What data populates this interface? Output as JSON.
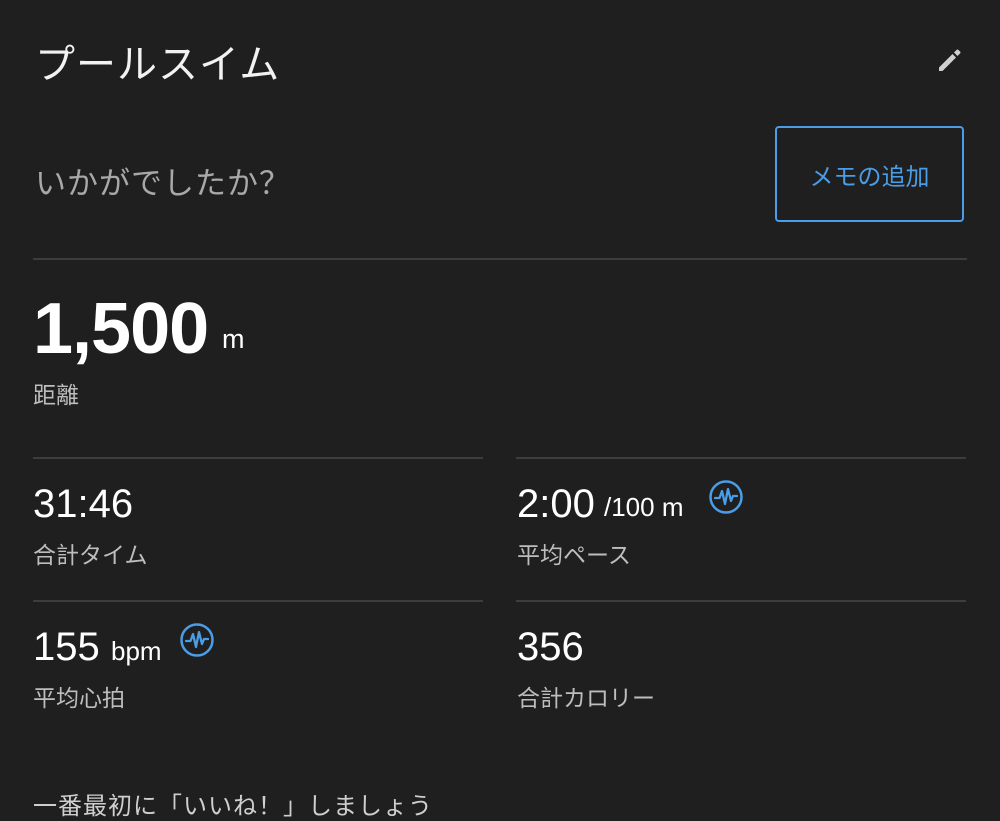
{
  "header": {
    "title": "プールスイム",
    "edit_icon": "pencil-icon"
  },
  "feedback": {
    "question": "いかがでしたか？",
    "memo_button": "メモの追加"
  },
  "distance": {
    "value": "1,500",
    "unit": "m",
    "label": "距離"
  },
  "stats": {
    "total_time": {
      "value": "31:46",
      "label": "合計タイム"
    },
    "avg_pace": {
      "value": "2:00",
      "unit": "/100 m",
      "label": "平均ペース",
      "icon": "heart-rate-icon"
    },
    "avg_hr": {
      "value": "155",
      "unit": "bpm",
      "label": "平均心拍",
      "icon": "heart-rate-icon"
    },
    "calories": {
      "value": "356",
      "label": "合計カロリー"
    }
  },
  "footer": {
    "text": "一番最初に「いいね！」しましょう"
  },
  "colors": {
    "background": "#1f1f1f",
    "accent": "#4a9de6",
    "divider": "#3d3d3d"
  }
}
